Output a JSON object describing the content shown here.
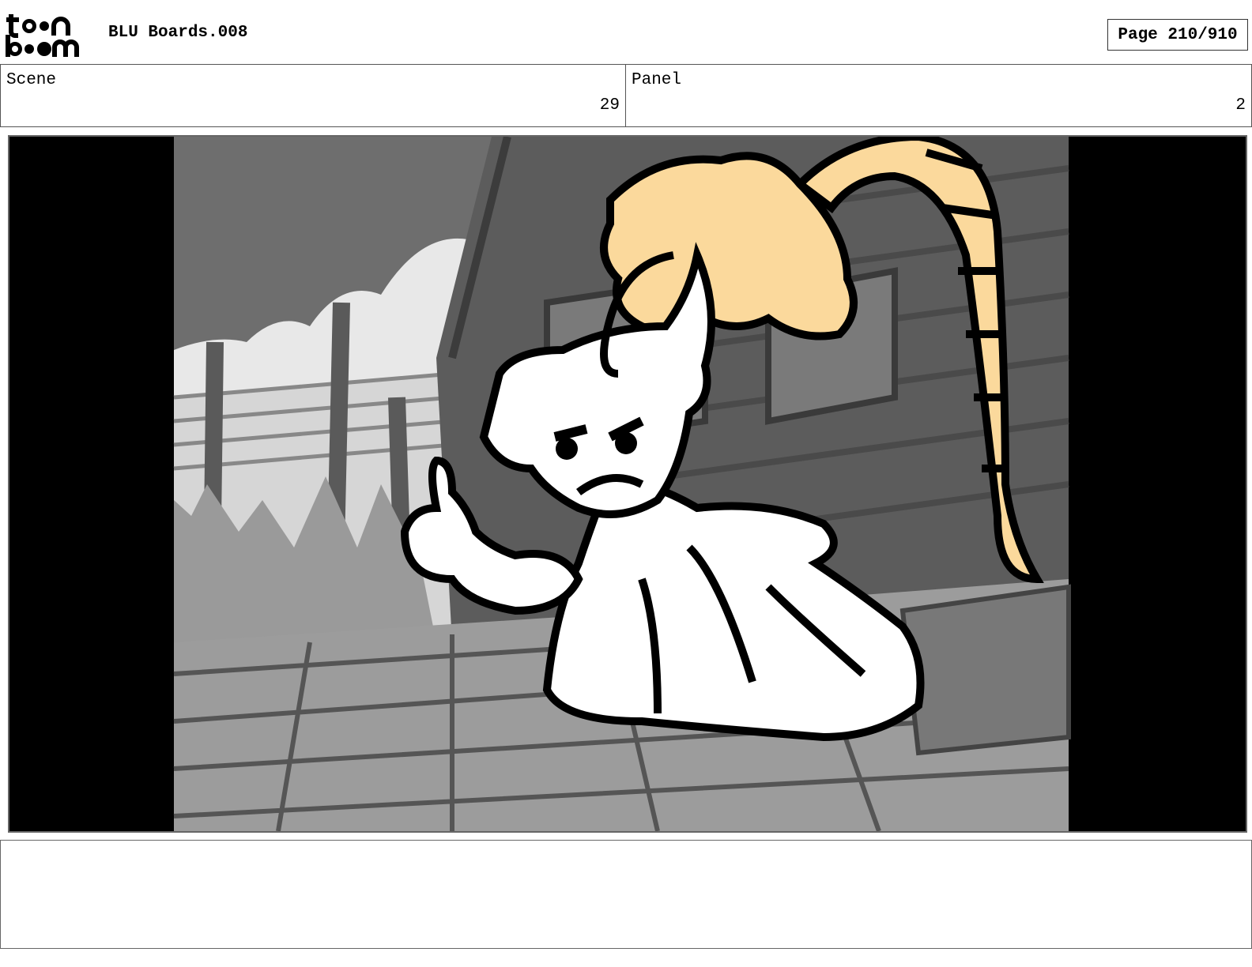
{
  "header": {
    "logo_text": "toonboom",
    "doc_title": "BLU Boards.008",
    "page_label": "Page 210/910"
  },
  "scene": {
    "label": "Scene",
    "value": "29"
  },
  "panel": {
    "label": "Panel",
    "value": "2"
  },
  "notes": {
    "text": ""
  },
  "colors": {
    "sketch_fill": "#ffffff",
    "hair_fill": "#fbd99c",
    "letterbox": "#000000"
  }
}
